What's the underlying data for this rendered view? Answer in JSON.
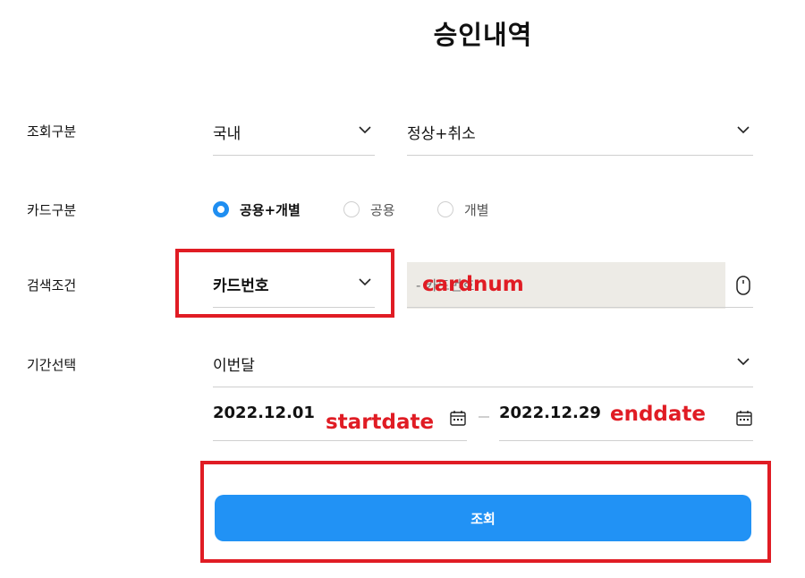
{
  "page": {
    "title": "승인내역"
  },
  "form": {
    "inquiry_type": {
      "label": "조회구분",
      "region_value": "국내",
      "status_value": "정상+취소"
    },
    "card_type": {
      "label": "카드구분",
      "options": [
        {
          "label": "공용+개별",
          "checked": true
        },
        {
          "label": "공용",
          "checked": false
        },
        {
          "label": "개별",
          "checked": false
        }
      ]
    },
    "search_condition": {
      "label": "검색조건",
      "select_value": "카드번호",
      "input_placeholder": "- 카드번호"
    },
    "period": {
      "label": "기간선택",
      "select_value": "이번달",
      "start_date": "2022.12.01",
      "end_date": "2022.12.29"
    },
    "submit_label": "조회"
  },
  "annotations": {
    "cardnum": "cardnum",
    "startdate": "startdate",
    "enddate": "enddate"
  },
  "colors": {
    "accent": "#2192f5",
    "annotation_red": "#e01c24",
    "input_bg": "#edebe6"
  }
}
